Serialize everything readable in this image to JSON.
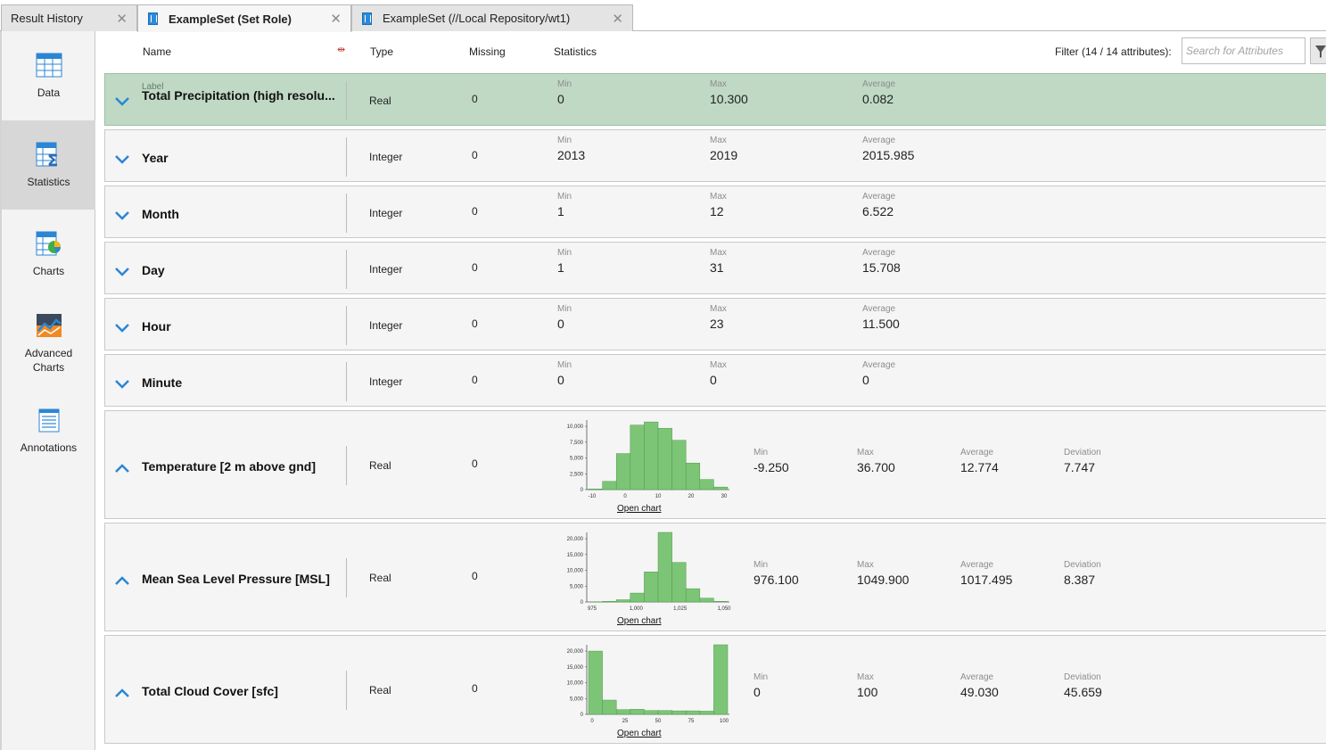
{
  "tabs": [
    {
      "label": "Result History"
    },
    {
      "label": "ExampleSet (Set Role)"
    },
    {
      "label": "ExampleSet (//Local Repository/wt1)"
    }
  ],
  "nav": [
    {
      "label": "Data",
      "icon": "table-icon"
    },
    {
      "label": "Statistics",
      "icon": "statistics-icon"
    },
    {
      "label": "Charts",
      "icon": "chart-icon"
    },
    {
      "label": "Advanced\nCharts",
      "icon": "advanced-chart-icon"
    },
    {
      "label": "Annotations",
      "icon": "notepad-icon"
    }
  ],
  "header": {
    "name": "Name",
    "type": "Type",
    "missing": "Missing",
    "statistics": "Statistics",
    "filter_label": "Filter (14 / 14 attributes):",
    "search_placeholder": "Search for Attributes"
  },
  "stat_labels": {
    "min": "Min",
    "max": "Max",
    "average": "Average",
    "deviation": "Deviation",
    "open_chart": "Open chart",
    "role": "Label"
  },
  "rows": [
    {
      "name": "Total Precipitation (high resolu...",
      "role": "Label",
      "type": "Real",
      "missing": "0",
      "min": "0",
      "max": "10.300",
      "avg": "0.082"
    },
    {
      "name": "Year",
      "type": "Integer",
      "missing": "0",
      "min": "2013",
      "max": "2019",
      "avg": "2015.985"
    },
    {
      "name": "Month",
      "type": "Integer",
      "missing": "0",
      "min": "1",
      "max": "12",
      "avg": "6.522"
    },
    {
      "name": "Day",
      "type": "Integer",
      "missing": "0",
      "min": "1",
      "max": "31",
      "avg": "15.708"
    },
    {
      "name": "Hour",
      "type": "Integer",
      "missing": "0",
      "min": "0",
      "max": "23",
      "avg": "11.500"
    },
    {
      "name": "Minute",
      "type": "Integer",
      "missing": "0",
      "min": "0",
      "max": "0",
      "avg": "0"
    },
    {
      "name": "Temperature  [2 m above gnd]",
      "type": "Real",
      "missing": "0",
      "min": "-9.250",
      "max": "36.700",
      "avg": "12.774",
      "dev": "7.747"
    },
    {
      "name": "Mean Sea Level Pressure  [MSL]",
      "type": "Real",
      "missing": "0",
      "min": "976.100",
      "max": "1049.900",
      "avg": "1017.495",
      "dev": "8.387"
    },
    {
      "name": "Total Cloud Cover  [sfc]",
      "type": "Real",
      "missing": "0",
      "min": "0",
      "max": "100",
      "avg": "49.030",
      "dev": "45.659"
    }
  ],
  "chart_data": [
    {
      "type": "bar",
      "xlim": [
        -12.5,
        40
      ],
      "ylim": [
        0,
        10000
      ],
      "yticks": [
        "0",
        "2,500",
        "5,000",
        "7,500",
        "10,000"
      ],
      "xticks": [
        "-10",
        "0",
        "10",
        "20",
        "30"
      ],
      "bins_x": [
        -7.5,
        -2.5,
        2.5,
        7.5,
        12.5,
        17.5,
        22.5,
        27.5,
        32.5
      ],
      "values": [
        100,
        1300,
        5700,
        10200,
        10700,
        9700,
        7800,
        4200,
        1600,
        400
      ]
    },
    {
      "type": "bar",
      "xlim": [
        975,
        1051
      ],
      "ylim": [
        0,
        20000
      ],
      "yticks": [
        "0",
        "5,000",
        "10,000",
        "15,000",
        "20,000"
      ],
      "xticks": [
        "975",
        "1,000",
        "1,025",
        "1,050"
      ],
      "values": [
        50,
        200,
        700,
        2800,
        9500,
        22000,
        12500,
        4200,
        1200,
        200
      ]
    },
    {
      "type": "bar",
      "xlim": [
        0,
        100
      ],
      "ylim": [
        0,
        20000
      ],
      "yticks": [
        "0",
        "5,000",
        "10,000",
        "15,000",
        "20,000"
      ],
      "xticks": [
        "0",
        "25",
        "50",
        "75",
        "100"
      ],
      "values": [
        20000,
        4500,
        1500,
        1600,
        1200,
        1200,
        1100,
        1100,
        1000,
        22000
      ]
    }
  ]
}
